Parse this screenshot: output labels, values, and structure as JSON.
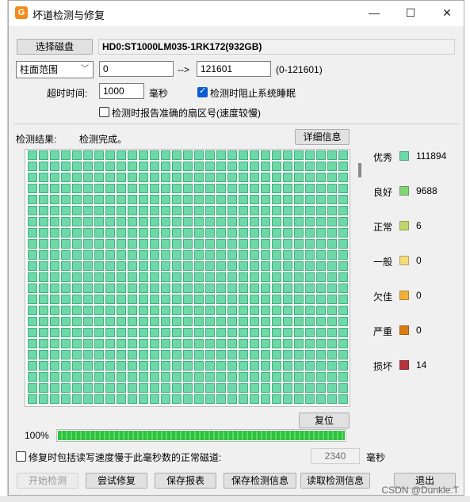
{
  "window": {
    "title": "坏道检测与修复",
    "icon_text": "G"
  },
  "controls": {
    "select_disk_button": "选择磁盘",
    "disk_name": "HD0:ST1000LM035-1RK172(932GB)",
    "range_mode": "柱面范围",
    "range_start": "0",
    "range_arrow": "-->",
    "range_end": "121601",
    "range_hint": "(0-121601)",
    "timeout_label": "超时时间:",
    "timeout_value": "1000",
    "timeout_unit": "毫秒",
    "prevent_sleep_label": "检测时阻止系统睡眠",
    "prevent_sleep_checked": true,
    "report_sector_label": "检测时报告准确的扇区号(速度较慢)",
    "report_sector_checked": false
  },
  "results": {
    "label": "检测结果:",
    "status": "检测完成。",
    "detail_button": "详细信息",
    "reset_button": "复位",
    "progress_text": "100%",
    "progress_fraction": 1.0,
    "cell_color": "#6dd8a8"
  },
  "legend": [
    {
      "label": "优秀",
      "value": "111894",
      "color": "#6dd8a8"
    },
    {
      "label": "良好",
      "value": "9688",
      "color": "#86d47a"
    },
    {
      "label": "正常",
      "value": "6",
      "color": "#bfd76a"
    },
    {
      "label": "一般",
      "value": "0",
      "color": "#f3dc7b"
    },
    {
      "label": "欠佳",
      "value": "0",
      "color": "#f2b23a"
    },
    {
      "label": "严重",
      "value": "0",
      "color": "#d97d12"
    },
    {
      "label": "损坏",
      "value": "14",
      "color": "#b8323c"
    }
  ],
  "repair": {
    "slow_track_label": "修复时包括读写速度慢于此毫秒数的正常磁道:",
    "slow_track_value": "2340",
    "slow_track_unit": "毫秒"
  },
  "buttons": {
    "start": "开始检测",
    "try_repair": "尝试修复",
    "save_report": "保存报表",
    "save_check_info": "保存检测信息",
    "load_check_info": "读取检测信息",
    "exit": "退出"
  },
  "watermark": "CSDN @Dunkle.T"
}
